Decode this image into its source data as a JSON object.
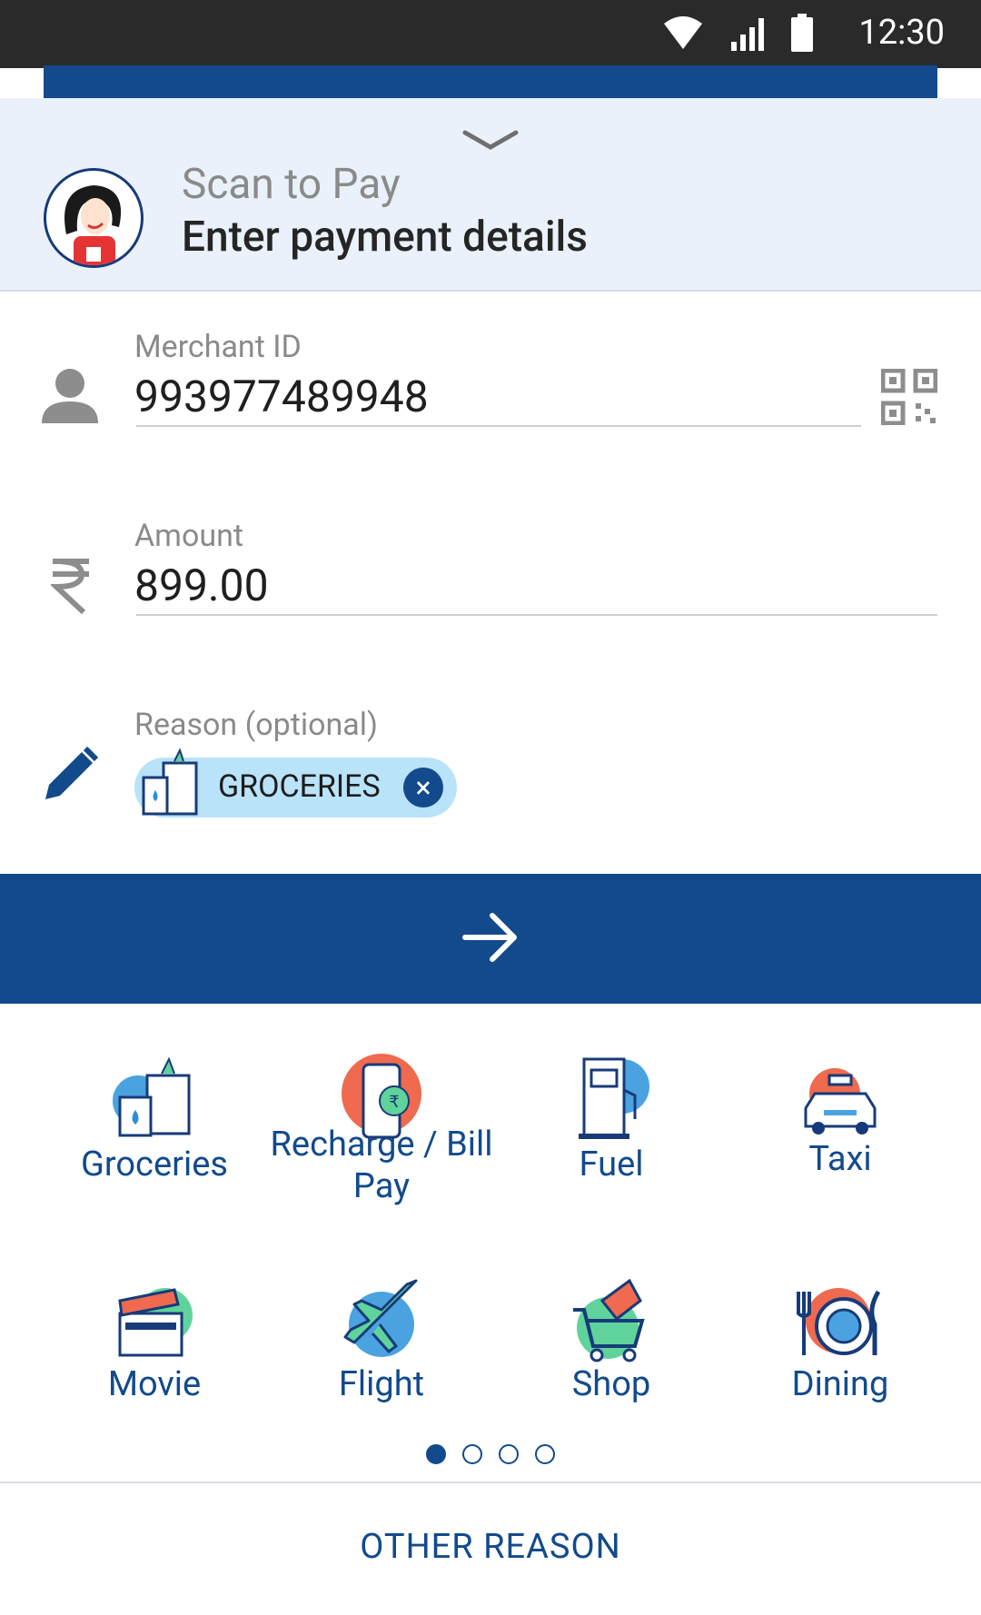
{
  "status": {
    "time": "12:30"
  },
  "header": {
    "subtitle": "Scan to Pay",
    "title": "Enter payment details"
  },
  "merchant": {
    "label": "Merchant ID",
    "value": "993977489948"
  },
  "amount": {
    "label": "Amount",
    "value": "899.00"
  },
  "reason": {
    "label": "Reason (optional)",
    "chip": "GROCERIES"
  },
  "categories": [
    {
      "label": "Groceries"
    },
    {
      "label": "Recharge / Bill Pay"
    },
    {
      "label": "Fuel"
    },
    {
      "label": "Taxi"
    },
    {
      "label": "Movie"
    },
    {
      "label": "Flight"
    },
    {
      "label": "Shop"
    },
    {
      "label": "Dining"
    }
  ],
  "pager": {
    "pages": 4,
    "active": 1
  },
  "footer": {
    "other_label": "OTHER REASON"
  },
  "colors": {
    "brand": "#124a8c",
    "header_bg": "#eaf1fa",
    "chip_bg": "#b9e3f8"
  },
  "icons": [
    "wifi-icon",
    "signal-icon",
    "battery-icon",
    "chevron-down-icon",
    "person-icon",
    "qr-code-icon",
    "rupee-icon",
    "pencil-icon",
    "arrow-right-icon",
    "close-icon"
  ]
}
